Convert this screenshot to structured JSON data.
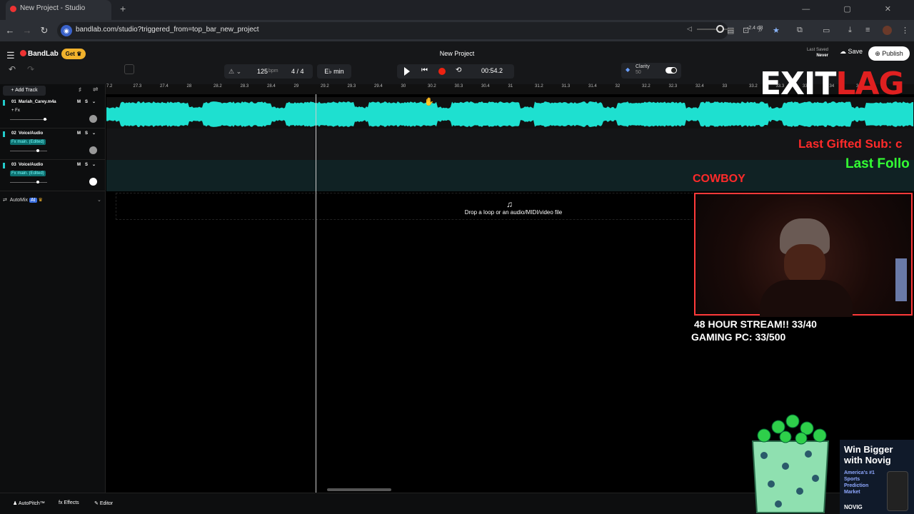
{
  "browser": {
    "tab_title": "New Project - Studio",
    "new_tab": "+",
    "window_controls": "— ▢ ✕",
    "url": "bandlab.com/studio?triggered_from=top_bar_new_project"
  },
  "header": {
    "logo": "BandLab",
    "get_label": "Get",
    "project_title": "New Project",
    "last_saved_label": "Last Saved",
    "last_saved_value": "Never",
    "save_label": "Save",
    "publish_label": "Publish"
  },
  "controls": {
    "bpm": "125",
    "bpm_unit": "bpm",
    "time_signature": "4 / 4",
    "key": "E♭ min",
    "time": "00:54.2",
    "clarity_label": "Clarity",
    "clarity_value": "50",
    "volume_db": "-2.4 dB"
  },
  "ruler": {
    "ticks": [
      "7.2",
      "27.3",
      "27.4",
      "28",
      "28.2",
      "28.3",
      "28.4",
      "29",
      "29.2",
      "29.3",
      "29.4",
      "30",
      "30.2",
      "30.3",
      "30.4",
      "31",
      "31.2",
      "31.3",
      "31.4",
      "32",
      "32.2",
      "32.3",
      "32.4",
      "33",
      "33.2",
      "33.3",
      "33.4",
      "34",
      "34.2"
    ]
  },
  "tracks": [
    {
      "number": "01",
      "name": "Mariah_Carey.m4a",
      "fx": "+ Fx",
      "fx_on": false,
      "vol": 0.95
    },
    {
      "number": "02",
      "name": "Voice/Audio",
      "fx": "Fx main. (Edited)",
      "fx_on": true,
      "vol": 0.75
    },
    {
      "number": "03",
      "name": "Voice/Audio",
      "fx": "Fx main. (Edited)",
      "fx_on": true,
      "vol": 0.75
    }
  ],
  "track_buttons": {
    "mute": "M",
    "solo": "S"
  },
  "sidebar": {
    "add_track_label": "Add Track",
    "automix_label": "AutoMix",
    "automix_badge": "AI"
  },
  "dropzone_text": "Drop a loop or an audio/MIDI/video file",
  "bottom": {
    "autopitch": "AutoPitch™",
    "effects": "Effects",
    "editor": "Editor"
  },
  "overlay": {
    "exitlag_white": "EXIT",
    "exitlag_red": "LAG",
    "gifted": "Last Gifted Sub: c",
    "follower": "Last Follo",
    "cowboy": "COWBOY",
    "goal1": "48 HOUR STREAM!! 33/40",
    "goal2": "GAMING PC: 33/500",
    "ad_head": "Win Bigger with Novig",
    "ad_sub": "America's #1 Sports Prediction Market",
    "ad_brand": "NOVIG"
  },
  "colors": {
    "waveform": "#1ee0d0",
    "record": "#e21111",
    "accent_gold": "#f1b22c"
  }
}
